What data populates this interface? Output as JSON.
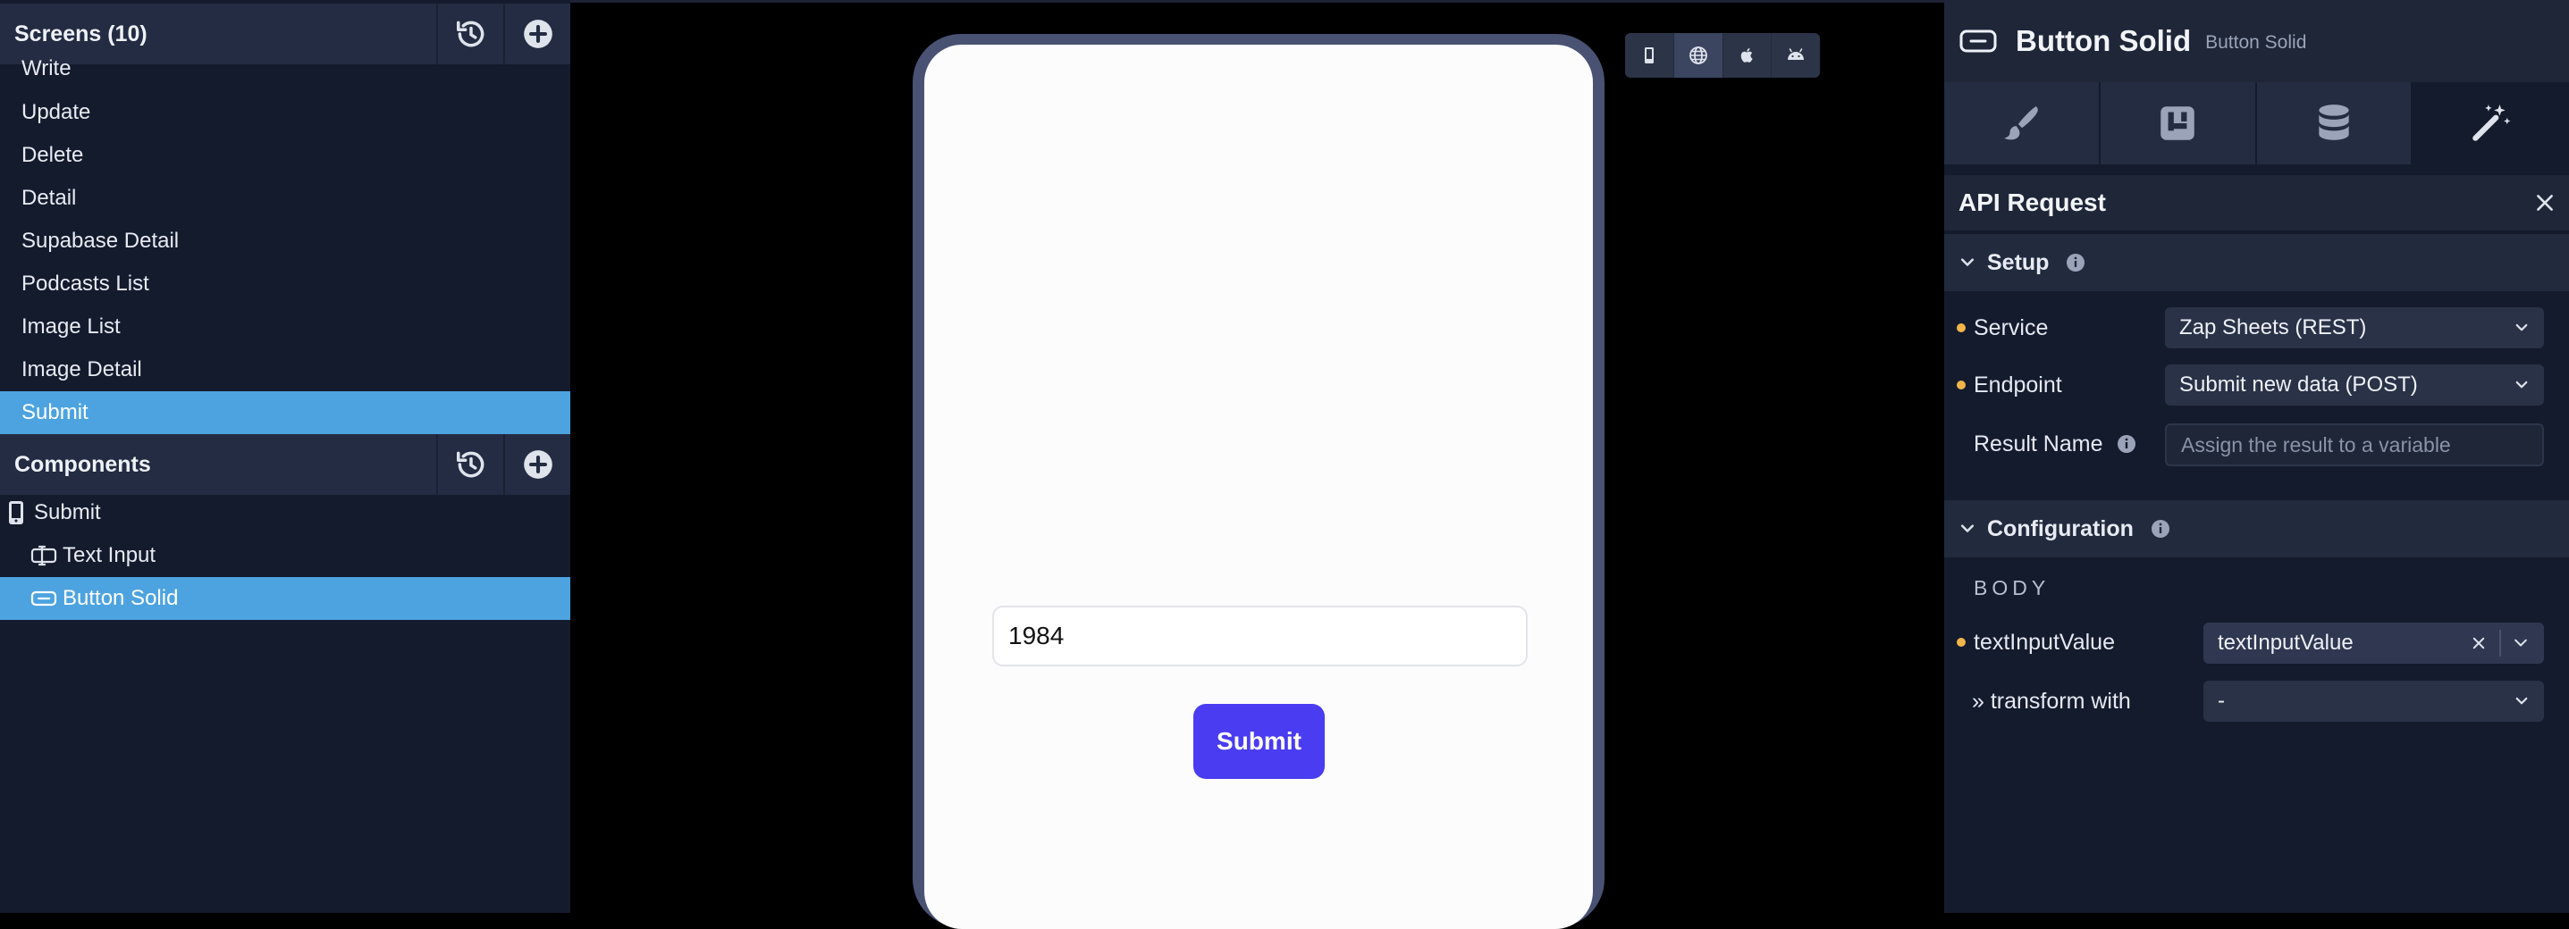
{
  "left_panel": {
    "screens": {
      "title": "Screens (10)",
      "items": [
        {
          "label": "Write"
        },
        {
          "label": "Update"
        },
        {
          "label": "Delete"
        },
        {
          "label": "Detail"
        },
        {
          "label": "Supabase Detail"
        },
        {
          "label": "Podcasts List"
        },
        {
          "label": "Image List"
        },
        {
          "label": "Image Detail"
        },
        {
          "label": "Submit",
          "selected": true
        }
      ]
    },
    "components": {
      "title": "Components",
      "items": [
        {
          "label": "Submit",
          "icon": "phone-icon"
        },
        {
          "label": "Text Input",
          "icon": "text-input-icon"
        },
        {
          "label": "Button Solid",
          "icon": "button-icon",
          "selected": true
        }
      ]
    }
  },
  "canvas": {
    "text_input_value": "1984",
    "submit_button_label": "Submit",
    "device_toggles": [
      "mobile-icon",
      "web-icon",
      "apple-icon",
      "android-icon"
    ]
  },
  "right_panel": {
    "title": "Button Solid",
    "subtitle": "Button Solid",
    "tabs": [
      "brush-icon",
      "layout-icon",
      "database-icon",
      "magic-wand-icon"
    ],
    "api_request": {
      "title": "API Request",
      "setup": {
        "title": "Setup",
        "service_label": "Service",
        "service_value": "Zap Sheets (REST)",
        "endpoint_label": "Endpoint",
        "endpoint_value": "Submit new data (POST)",
        "result_label": "Result Name",
        "result_placeholder": "Assign the result to a variable"
      },
      "configuration": {
        "title": "Configuration",
        "body_label": "BODY",
        "field_label": "textInputValue",
        "field_value": "textInputValue",
        "transform_label": "» transform with",
        "transform_value": "-"
      }
    }
  },
  "colors": {
    "selection": "#4da3e0",
    "primary_button": "#4a3cf0",
    "required_dot": "#f1b54a"
  }
}
